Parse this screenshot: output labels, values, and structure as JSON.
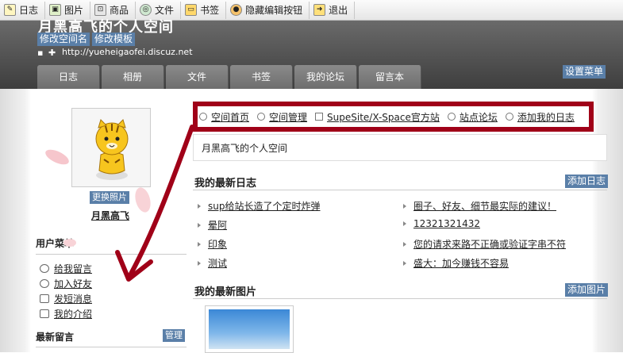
{
  "toolbar": {
    "items": [
      {
        "label": "日志",
        "icon": "edit-icon"
      },
      {
        "label": "图片",
        "icon": "image-icon"
      },
      {
        "label": "商品",
        "icon": "cart-icon"
      },
      {
        "label": "文件",
        "icon": "globe-icon"
      },
      {
        "label": "书签",
        "icon": "folder-icon"
      },
      {
        "label": "隐藏编辑按钮",
        "icon": "user-icon"
      },
      {
        "label": "退出",
        "icon": "exit-icon"
      }
    ]
  },
  "header": {
    "title": "月黑高飞的个人空间",
    "edit_name_label": "修改空间名",
    "edit_template_label": "修改模板",
    "url": "http://yueheigaofei.discuz.net",
    "settings_menu_label": "设置菜单"
  },
  "tabs": [
    "日志",
    "相册",
    "文件",
    "书签",
    "我的论坛",
    "留言本"
  ],
  "profile": {
    "change_photo_label": "更换照片",
    "username": "月黑高飞"
  },
  "user_menu": {
    "title": "用户菜单",
    "items": [
      "给我留言",
      "加入好友",
      "发短消息",
      "我的介绍"
    ]
  },
  "latest_messages": {
    "title": "最新留言",
    "manage_label": "管理"
  },
  "nav_links": [
    "空间首页",
    "空间管理",
    "SupeSite/X-Space官方站",
    "站点论坛",
    "添加我的日志"
  ],
  "space_name": "月黑高飞的个人空间",
  "latest_posts": {
    "title": "我的最新日志",
    "add_label": "添加日志",
    "left": [
      "sup给站长造了个定时炸弹",
      "晕阿",
      "印象",
      "测试"
    ],
    "right": [
      "圈子、好友、细节最实际的建议！",
      "12321321432",
      "您的请求来路不正确或验证字串不符",
      "盛大：加今赚钱不容易"
    ]
  },
  "latest_photos": {
    "title": "我的最新图片",
    "add_label": "添加图片"
  },
  "colors": {
    "highlight_border": "#a00018",
    "button_blue": "#5a7fa8"
  }
}
